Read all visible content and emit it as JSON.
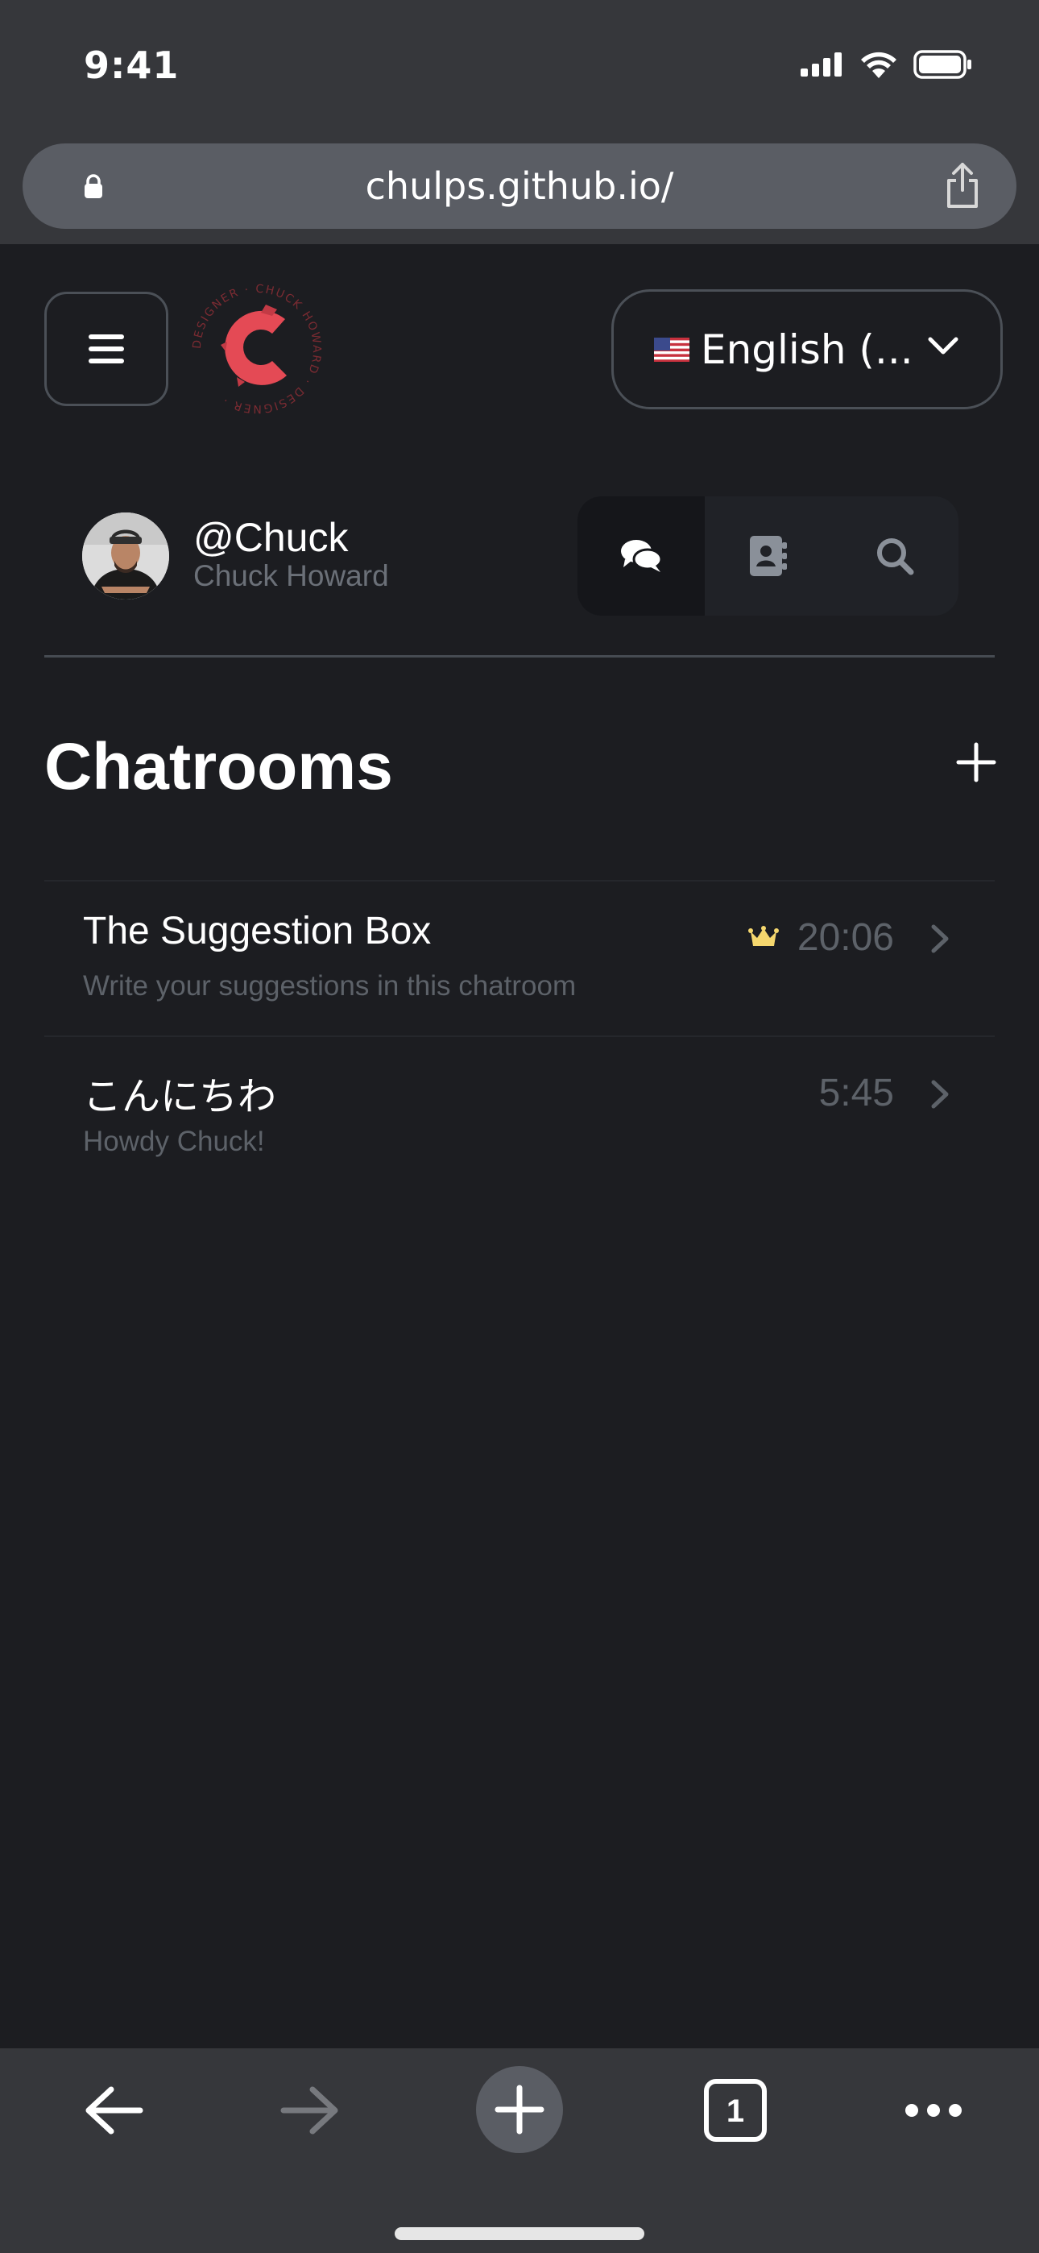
{
  "status_bar": {
    "time": "9:41",
    "icons": [
      "signal-icon",
      "wifi-icon",
      "battery-icon"
    ]
  },
  "browser": {
    "url": "chulps.github.io/",
    "lock_icon": "lock-icon",
    "share_icon": "share-icon"
  },
  "header": {
    "menu_icon": "hamburger-icon",
    "logo_ring_text": "DESIGNER · CHUCK HOWARD · DESIGNER ·",
    "logo_color": "#e44a55",
    "language": {
      "flag": "us-flag",
      "label": "English (..."
    }
  },
  "profile": {
    "handle": "@Chuck",
    "name": "Chuck Howard",
    "tabs": [
      {
        "icon": "chat-bubbles-icon",
        "active": true
      },
      {
        "icon": "contacts-book-icon",
        "active": false
      },
      {
        "icon": "search-icon",
        "active": false
      }
    ]
  },
  "chatrooms": {
    "title": "Chatrooms",
    "rooms": [
      {
        "name": "The Suggestion Box",
        "preview": "Write your suggestions in this chatroom",
        "time": "20:06",
        "owner_badge": "crown-icon"
      },
      {
        "name": "こんにちわ",
        "preview": "Howdy Chuck!",
        "time": "5:45"
      }
    ]
  },
  "toolbar": {
    "tab_count": "1"
  },
  "colors": {
    "page_bg": "#1c1d21",
    "chrome_bg": "#36373b",
    "muted_text": "#5d6269",
    "crown": "#f5d76e"
  }
}
